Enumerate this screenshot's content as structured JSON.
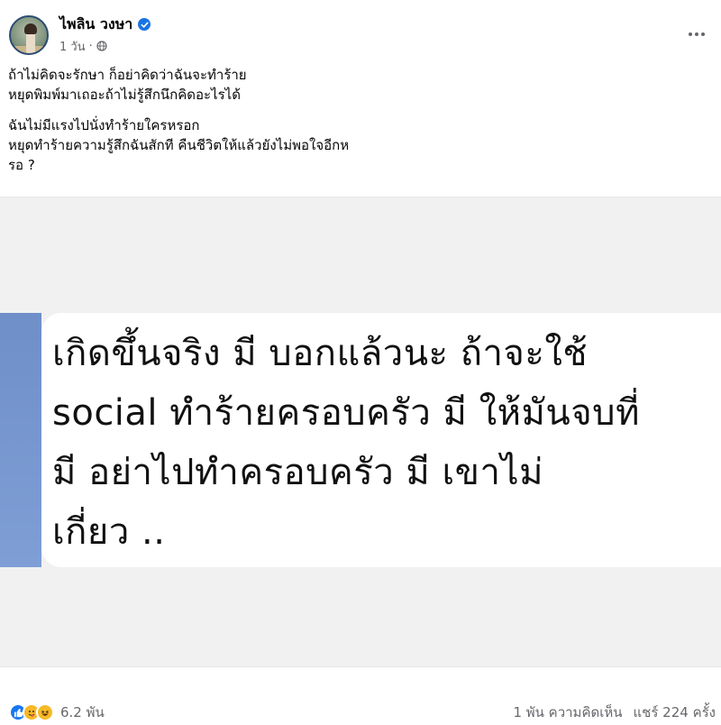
{
  "post": {
    "author_name": "ไพลิน วงษา",
    "time": "1 วัน",
    "separator": "·",
    "privacy_icon": "globe-icon",
    "more_icon": "more-options-icon",
    "caption": {
      "paragraph_1": "ถ้าไม่คิดจะรักษา ก็อย่าคิดว่าฉันจะทำร้าย\nหยุดพิมพ์มาเถอะถ้าไม่รู้สึกนึกคิดอะไรได้",
      "paragraph_2": "ฉันไม่มีแรงไปนั่งทำร้ายใครหรอก\nหยุดทำร้ายความรู้สึกฉันสักที คืนชีวิตให้แล้วยังไม่พอใจอีกห\nรอ ?"
    },
    "image_text": "เกิดขึ้นจริง    มี  บอกแล้วนะ ถ้าจะใช้\nsocial ทำร้ายครอบครัว  มี  ให้มันจบที่\n มี   อย่าไปทำครอบครัว  มี  เขาไม่\nเกี่ยว .."
  },
  "footer": {
    "reaction_icons": [
      "like-reaction-icon",
      "care-reaction-icon",
      "haha-reaction-icon"
    ],
    "reaction_count": "6.2 พัน",
    "comments": "1 พัน ความคิดเห็น",
    "shares": "แชร์ 224 ครั้ง"
  },
  "colors": {
    "accent_blue": "#1877f2",
    "verified_blue": "#1b74e4",
    "secondary_text": "#65676b",
    "quote_accent": "#7f9ed6"
  }
}
